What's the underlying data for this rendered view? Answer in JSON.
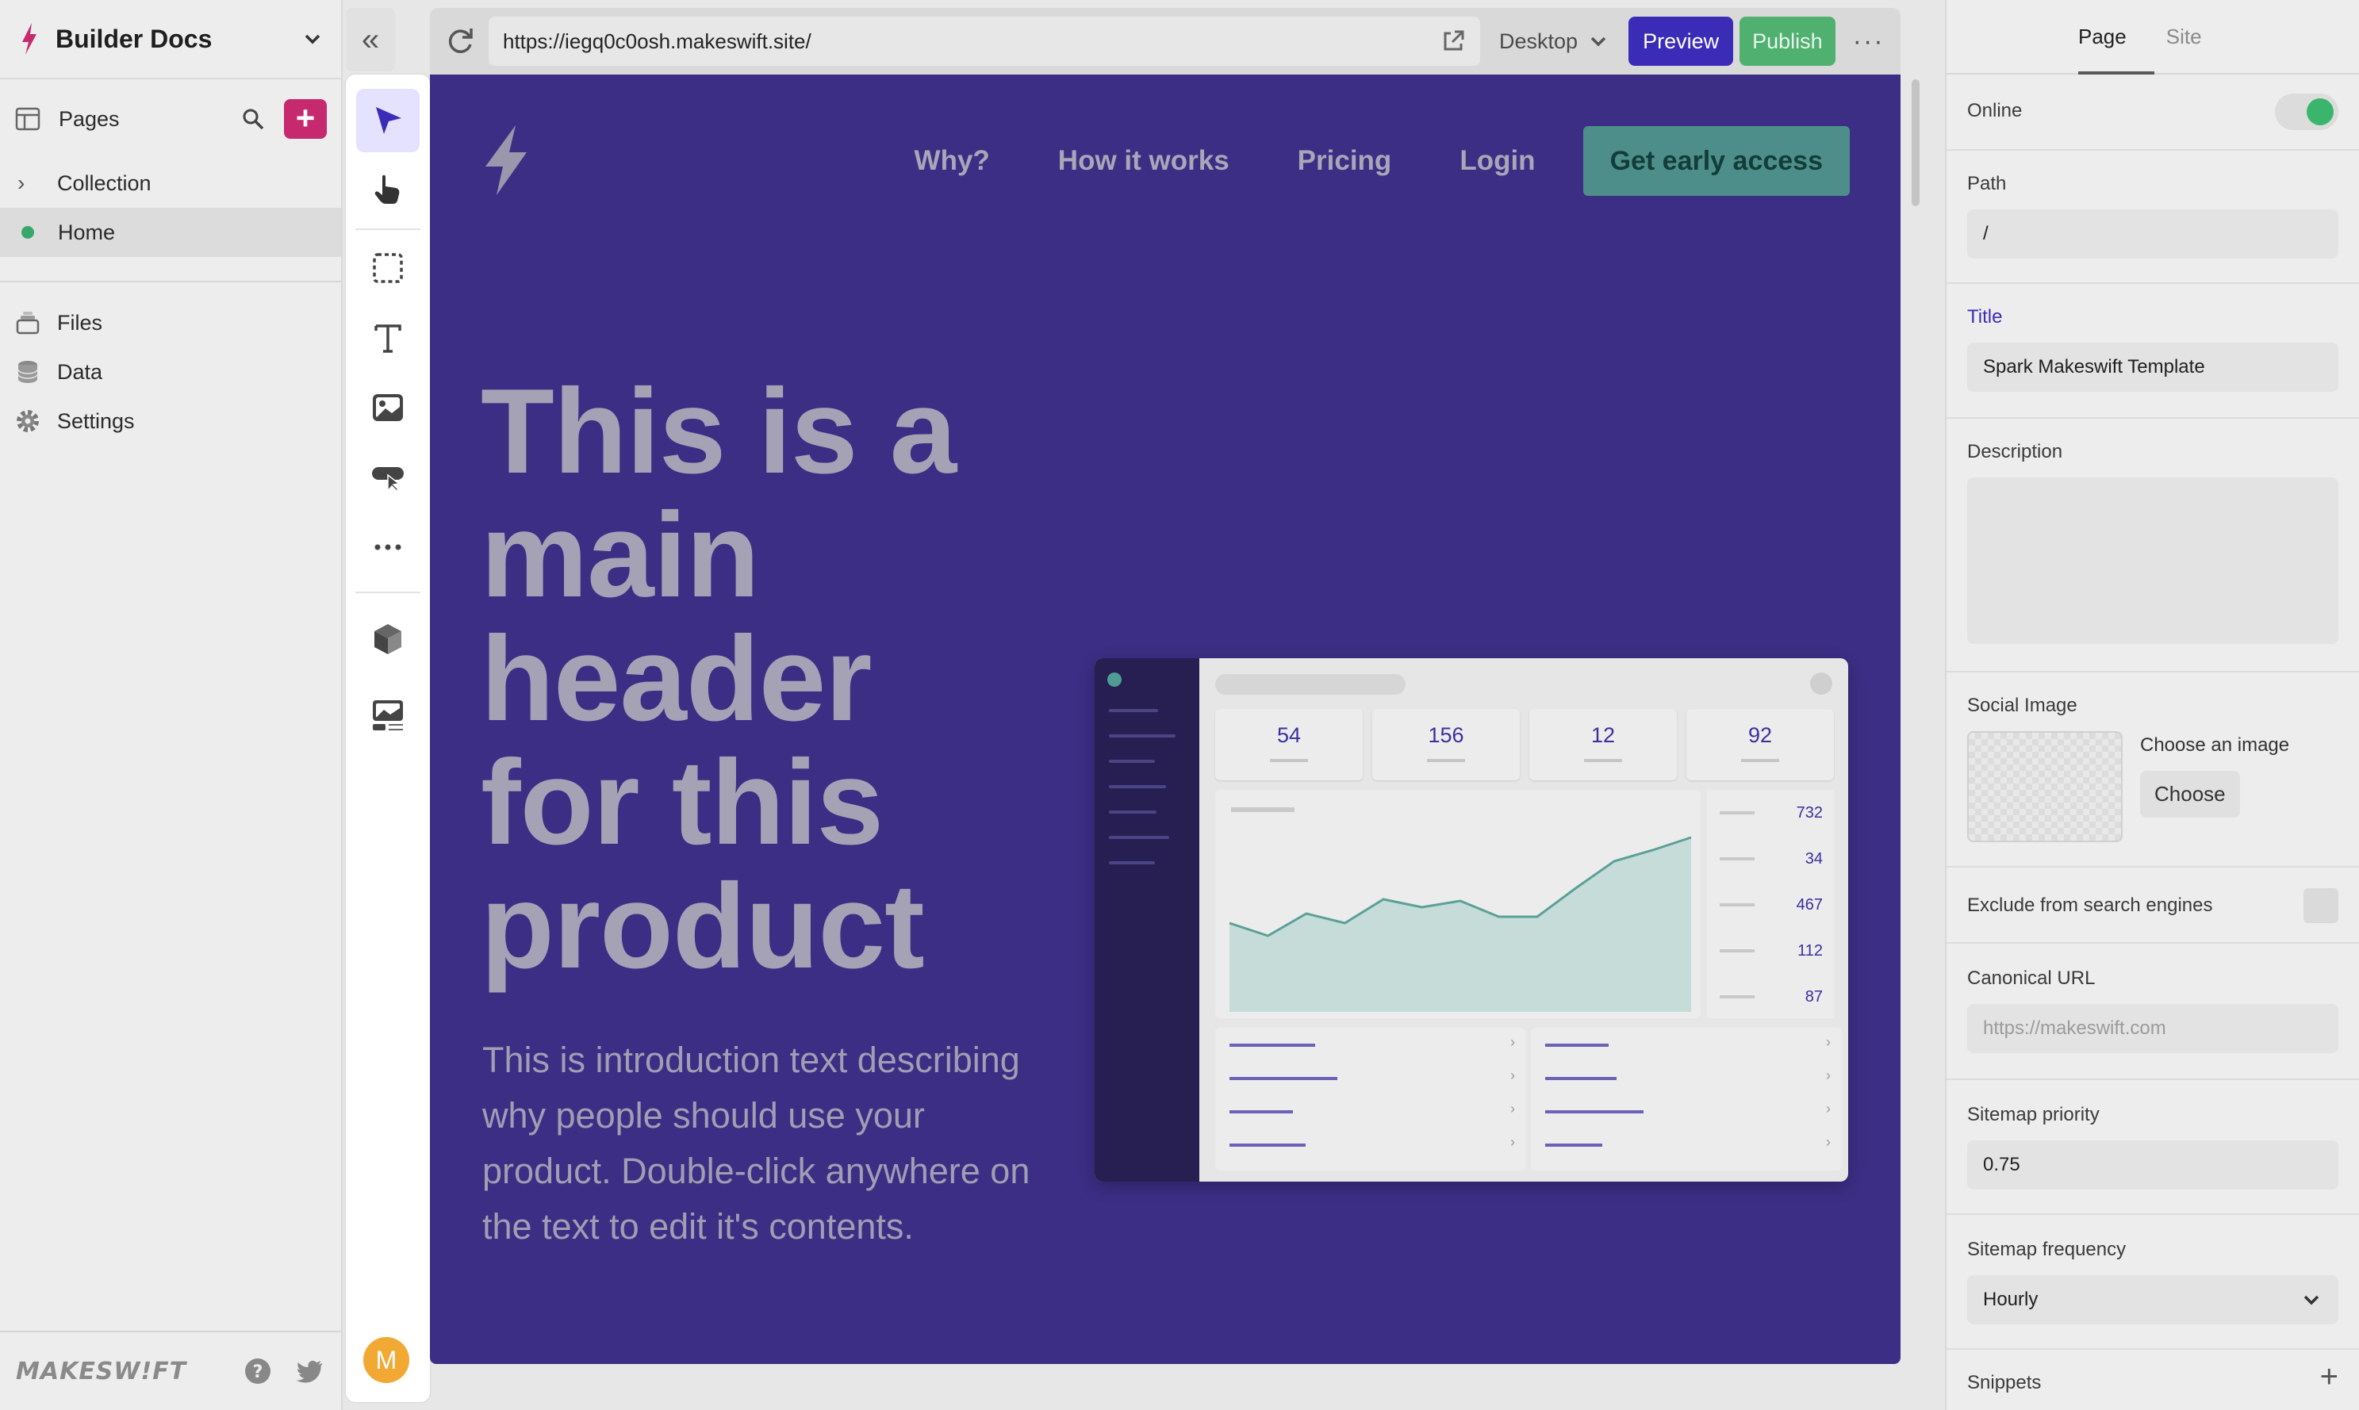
{
  "left_sidebar": {
    "site_name": "Builder Docs",
    "pages_label": "Pages",
    "tree": [
      {
        "label": "Collection",
        "type": "folder"
      },
      {
        "label": "Home",
        "type": "page",
        "active": true
      }
    ],
    "nav": [
      {
        "label": "Files",
        "icon": "files-icon"
      },
      {
        "label": "Data",
        "icon": "database-icon"
      },
      {
        "label": "Settings",
        "icon": "gear-icon"
      }
    ],
    "brand": "MAKESW!FT"
  },
  "tool_rail": {
    "tools": [
      "select-pointer-icon",
      "hand-icon",
      "box-select-icon",
      "text-tool-icon",
      "image-tool-icon",
      "button-tool-icon",
      "more-tools-icon",
      "component-cube-icon",
      "gallery-icon"
    ],
    "avatar_initial": "M"
  },
  "browser": {
    "url": "https://iegq0c0osh.makeswift.site/",
    "device": "Desktop",
    "preview_label": "Preview",
    "publish_label": "Publish",
    "more_label": "···"
  },
  "site": {
    "nav": [
      "Why?",
      "How it works",
      "Pricing",
      "Login"
    ],
    "cta": "Get early access",
    "hero_title": "This is a main header for this product",
    "hero_intro": "This is introduction text describing why people should use your product. Double-click anywhere on the text to edit it's contents.",
    "dashboard": {
      "stats": [
        "54",
        "156",
        "12",
        "92"
      ],
      "list_values": [
        "732",
        "34",
        "467",
        "112",
        "87"
      ],
      "trend": [
        0.36,
        0.28,
        0.42,
        0.36,
        0.51,
        0.46,
        0.5,
        0.4,
        0.4,
        0.58,
        0.75,
        0.82,
        0.9
      ]
    },
    "colors": {
      "bg": "#3c2e85",
      "cta_bg": "#4e8e8a",
      "text": "#a4a2b4"
    }
  },
  "right_panel": {
    "tabs": [
      "Page",
      "Site"
    ],
    "active_tab": "Page",
    "online_label": "Online",
    "online": true,
    "path_label": "Path",
    "path_value": "/",
    "title_label": "Title",
    "title_value": "Spark Makeswift Template",
    "description_label": "Description",
    "social_image_label": "Social Image",
    "choose_image_text": "Choose an image",
    "choose_button": "Choose",
    "exclude_label": "Exclude from search engines",
    "canonical_label": "Canonical URL",
    "canonical_placeholder": "https://makeswift.com",
    "sitemap_priority_label": "Sitemap priority",
    "sitemap_priority_value": "0.75",
    "sitemap_frequency_label": "Sitemap frequency",
    "sitemap_frequency_value": "Hourly",
    "snippets_label": "Snippets"
  }
}
